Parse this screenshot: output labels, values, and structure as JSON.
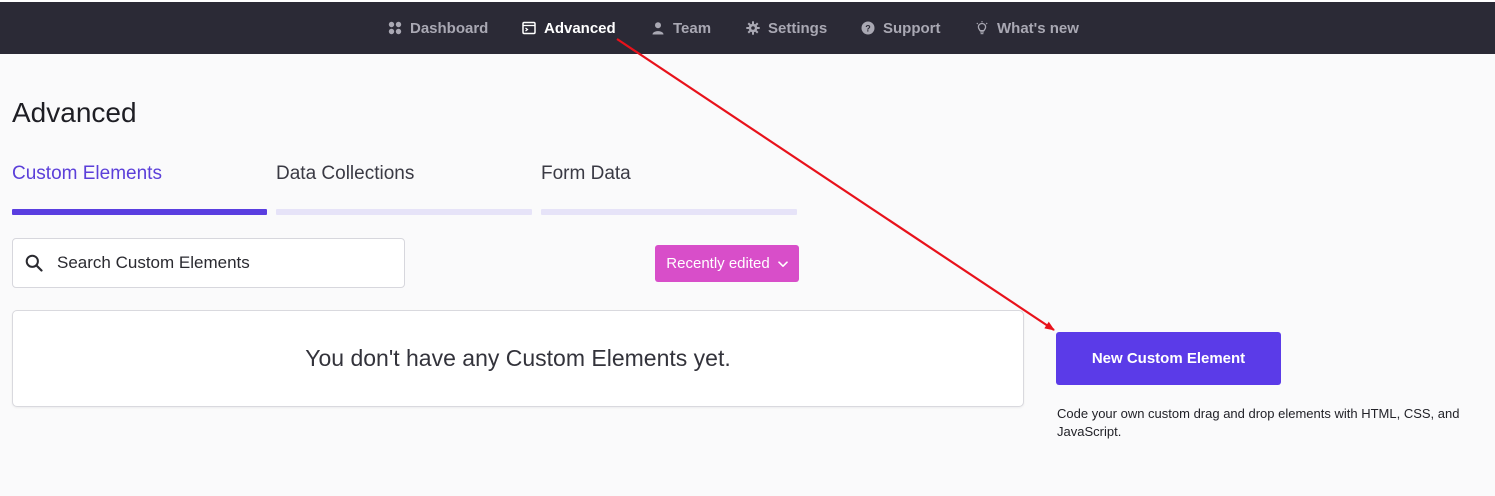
{
  "nav": {
    "items": [
      {
        "label": "Dashboard",
        "icon": "dashboard-grid-icon",
        "active": false
      },
      {
        "label": "Advanced",
        "icon": "terminal-window-icon",
        "active": true
      },
      {
        "label": "Team",
        "icon": "person-icon",
        "active": false
      },
      {
        "label": "Settings",
        "icon": "gear-icon",
        "active": false
      },
      {
        "label": "Support",
        "icon": "help-circle-icon",
        "active": false
      },
      {
        "label": "What's new",
        "icon": "lightbulb-icon",
        "active": false
      }
    ]
  },
  "page": {
    "title": "Advanced"
  },
  "tabs": [
    {
      "label": "Custom Elements",
      "active": true
    },
    {
      "label": "Data Collections",
      "active": false
    },
    {
      "label": "Form Data",
      "active": false
    }
  ],
  "search": {
    "placeholder": "Search Custom Elements",
    "value": ""
  },
  "sort": {
    "label": "Recently edited"
  },
  "empty_state": {
    "message": "You don't have any Custom Elements yet."
  },
  "sidebar_action": {
    "button_label": "New Custom Element",
    "help_text": "Code your own custom drag and drop elements with HTML, CSS, and JavaScript."
  },
  "colors": {
    "topbar_bg": "#2b2a36",
    "accent_purple": "#5b3be8",
    "active_tab": "#5b3fd9",
    "sort_button": "#d84ec9",
    "annotation_arrow": "#e8121b"
  }
}
